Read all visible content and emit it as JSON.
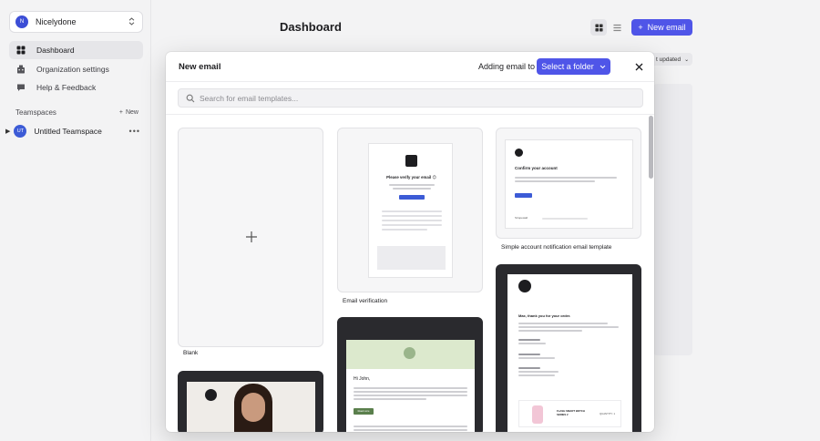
{
  "workspace": {
    "avatar": "N",
    "name": "Nicelydone"
  },
  "nav": [
    {
      "label": "Dashboard",
      "icon": "grid-icon",
      "active": true
    },
    {
      "label": "Organization settings",
      "icon": "building-icon",
      "active": false
    },
    {
      "label": "Help & Feedback",
      "icon": "chat-icon",
      "active": false
    }
  ],
  "teamspaces": {
    "heading": "Teamspaces",
    "new_label": "New",
    "items": [
      {
        "avatar": "UT",
        "name": "Untitled Teamspace"
      }
    ]
  },
  "main": {
    "title": "Dashboard",
    "new_email_label": "New email",
    "sort_label": "t updated"
  },
  "modal": {
    "title": "New email",
    "adding_label": "Adding email to",
    "folder_button": "Select a folder",
    "search_placeholder": "Search for email templates...",
    "templates": [
      {
        "label": "Blank"
      },
      {
        "label": "Email verification",
        "heading": "Please verify your email 😊",
        "button": "Verify my account"
      },
      {
        "label": "Simple account notification email template",
        "heading": "Confirm your account",
        "button": "Confirm",
        "brand": "Stropewall"
      },
      {
        "label": "",
        "heading": "Max, thank you for your order.",
        "product": "FLASH SMART WATCH SERIES 2",
        "quantity": "QUANTITY: 1"
      },
      {
        "label": "",
        "greeting": "Hi John,",
        "button": "Read more"
      },
      {
        "label": ""
      }
    ]
  },
  "colors": {
    "accent": "#4f55e8",
    "sidebar_bg": "#f3f3f4"
  }
}
